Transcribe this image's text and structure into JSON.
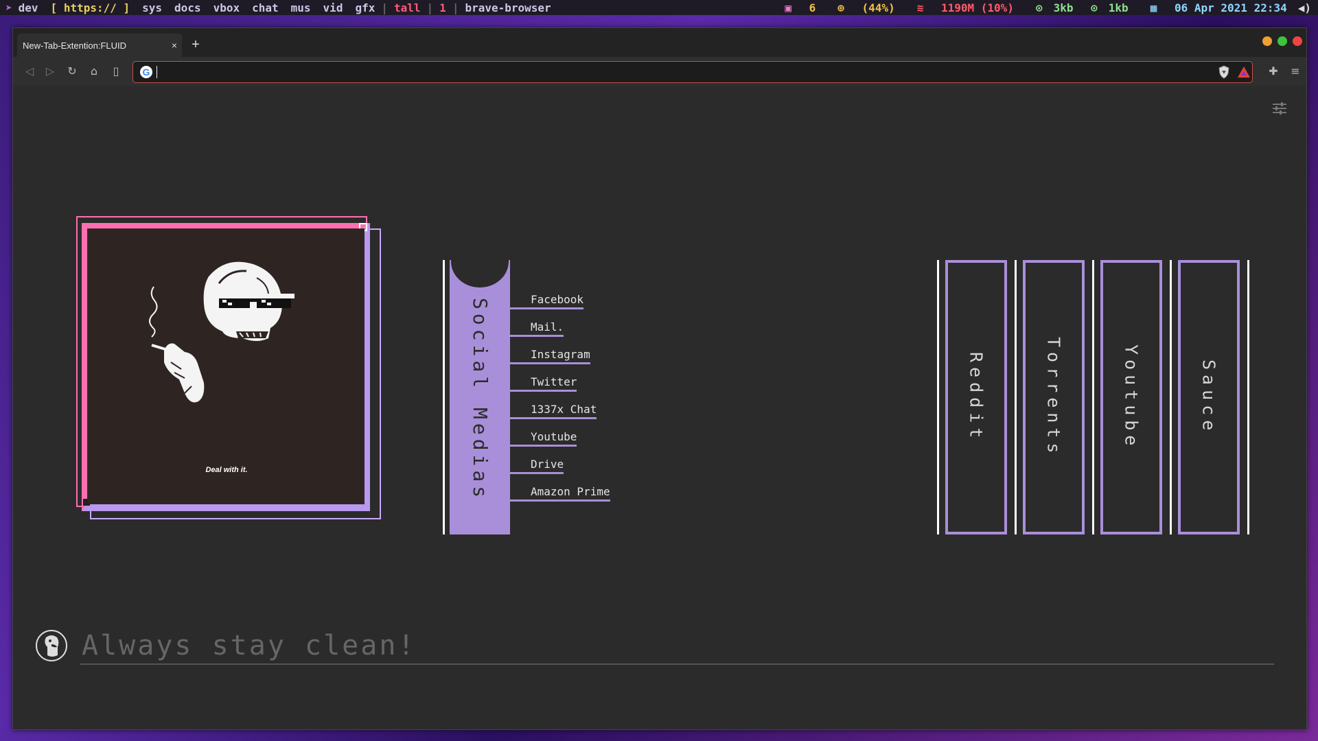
{
  "topbar": {
    "menu_icon": "arch-icon",
    "workspaces": [
      "dev",
      "[ https:// ]",
      "sys",
      "docs",
      "vbox",
      "chat",
      "mus",
      "vid",
      "gfx",
      "tall",
      "1",
      "brave-browser"
    ],
    "status": {
      "updates": "6",
      "battery": "(44%)",
      "memory": "1190M (10%)",
      "upload": "3kb",
      "download": "1kb",
      "datetime": "06 Apr 2021 22:34"
    }
  },
  "browser": {
    "tab_title": "New-Tab-Extention:FLUID",
    "tab_close": "×",
    "new_tab": "+",
    "window_dots": [
      "#f0a030",
      "#3cc43c",
      "#ee4444"
    ],
    "url_value": "",
    "accent": "#a98fd9"
  },
  "art": {
    "caption": "Deal with it."
  },
  "social": {
    "title": "Social Medias",
    "links": [
      "Facebook",
      "Mail.",
      "Instagram",
      "Twitter",
      "1337x Chat",
      "Youtube",
      "Drive",
      "Amazon Prime"
    ]
  },
  "columns": [
    "Reddit",
    "Torrents",
    "Youtube",
    "Sauce"
  ],
  "search": {
    "placeholder": "Always stay clean!"
  }
}
